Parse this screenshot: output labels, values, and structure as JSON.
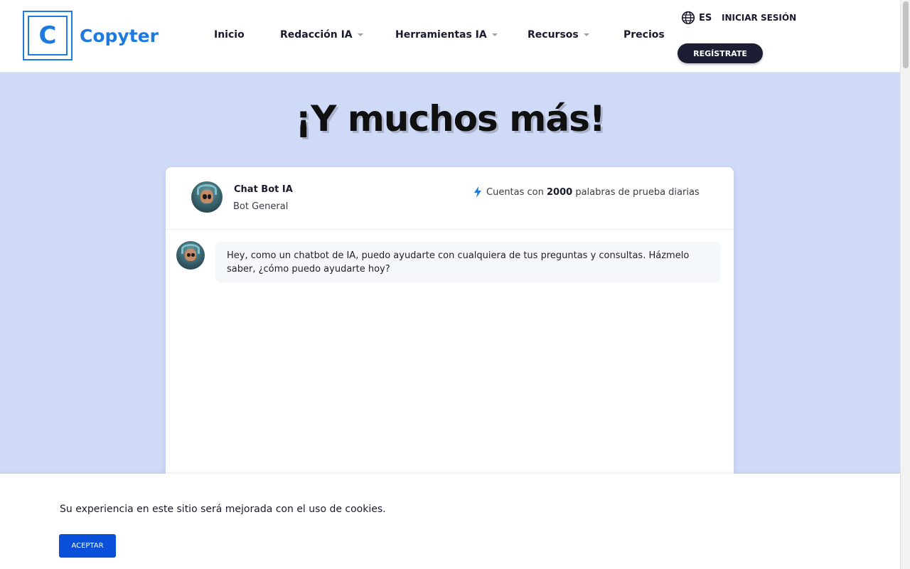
{
  "brand": {
    "logo_letter": "C",
    "name": "Copyter",
    "color": "#1f7ae0"
  },
  "nav": {
    "items": [
      {
        "label": "Inicio",
        "has_dropdown": false
      },
      {
        "label": "Redacción IA",
        "has_dropdown": true
      },
      {
        "label": "Herramientas IA",
        "has_dropdown": true
      },
      {
        "label": "Recursos",
        "has_dropdown": true
      },
      {
        "label": "Precios",
        "has_dropdown": false
      }
    ],
    "language": "ES",
    "login_label": "INICIAR SESIÓN",
    "register_label": "REGÍSTRATE"
  },
  "hero": {
    "title": "¡Y muchos más!"
  },
  "chat": {
    "bot_name": "Chat Bot IA",
    "bot_role": "Bot General",
    "quota_prefix": "Cuentas con",
    "quota_words": "2000",
    "quota_suffix": "palabras de prueba diarias",
    "messages": [
      {
        "sender": "bot",
        "text": "Hey, como un chatbot de IA, puedo ayudarte con cualquiera de tus preguntas y consultas. Házmelo saber, ¿cómo puedo ayudarte hoy?"
      }
    ]
  },
  "cookie_banner": {
    "text": "Su experiencia en este sitio será mejorada con el uso de cookies.",
    "accept_label": "ACEPTAR"
  },
  "colors": {
    "page_background": "#cfdaf7",
    "register_button": "#1c1e33",
    "accept_button": "#0a4fd9"
  }
}
